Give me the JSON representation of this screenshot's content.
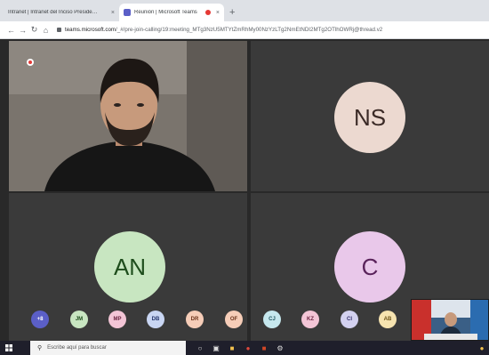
{
  "browser": {
    "tabs": [
      {
        "label": "Intranet | Intranet del Inciso Preside…",
        "active": false
      },
      {
        "label": "Reunión | Microsoft Teams",
        "active": true,
        "recording": true
      }
    ],
    "new_tab_glyph": "+",
    "close_glyph": "×",
    "url_host": "teams.microsoft.com",
    "url_path": "/_#/pre-join-calling/19:meeting_MTg3NzU5MTYtZmRhMy00NzYzLTg2NmEtNDI2MTg2OTlhOWRj@thread.v2"
  },
  "meeting": {
    "tiles": [
      {
        "type": "video",
        "description_icon": "video-feed"
      },
      {
        "type": "avatar",
        "initials": "NS",
        "bg": "#ecd9d0",
        "fg": "#3b2a26"
      },
      {
        "type": "avatar",
        "initials": "AN",
        "bg": "#c8e6c1",
        "fg": "#1e4d1c"
      },
      {
        "type": "avatar",
        "initials": "C",
        "bg": "#e9c8ea",
        "fg": "#5a235b"
      }
    ],
    "participants": [
      {
        "initials": "+8",
        "bg": "#5b5fc7",
        "fg": "#ffffff"
      },
      {
        "initials": "JM",
        "bg": "#c8e6c1",
        "fg": "#1e4d1c"
      },
      {
        "initials": "MP",
        "bg": "#f3c5d6",
        "fg": "#6b2340"
      },
      {
        "initials": "DB",
        "bg": "#c9d6f3",
        "fg": "#23346b"
      },
      {
        "initials": "DR",
        "bg": "#f6cdb8",
        "fg": "#6b3219"
      },
      {
        "initials": "OF",
        "bg": "#f6cdb8",
        "fg": "#6b3219"
      },
      {
        "initials": "CJ",
        "bg": "#c6e8ee",
        "fg": "#1f5560"
      },
      {
        "initials": "KZ",
        "bg": "#f3c5d6",
        "fg": "#6b2340"
      },
      {
        "initials": "CI",
        "bg": "#d3d1f0",
        "fg": "#35306b"
      },
      {
        "initials": "AB",
        "bg": "#f6e3b0",
        "fg": "#6b5217"
      }
    ]
  },
  "taskbar": {
    "search_placeholder": "Escribe aquí para buscar"
  },
  "colors": {
    "teams_purple": "#5b5fc7",
    "recording_red": "#e53935",
    "stage_bg": "#292929"
  }
}
